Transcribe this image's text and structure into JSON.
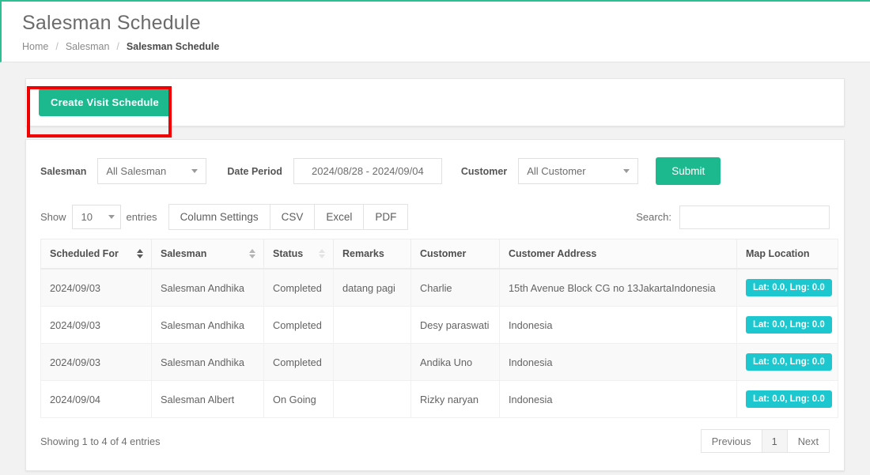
{
  "header": {
    "title": "Salesman Schedule",
    "breadcrumb": [
      {
        "label": "Home",
        "active": false
      },
      {
        "label": "Salesman",
        "active": false
      },
      {
        "label": "Salesman Schedule",
        "active": true
      }
    ],
    "separator": "/"
  },
  "action_card": {
    "create_button": "Create Visit Schedule"
  },
  "filters": {
    "salesman_label": "Salesman",
    "salesman_value": "All Salesman",
    "date_label": "Date Period",
    "date_value": "2024/08/28 - 2024/09/04",
    "customer_label": "Customer",
    "customer_value": "All Customer",
    "submit_label": "Submit"
  },
  "toolbar": {
    "show_label": "Show",
    "entries_label": "entries",
    "page_length": "10",
    "buttons": [
      "Column Settings",
      "CSV",
      "Excel",
      "PDF"
    ],
    "search_label": "Search:",
    "search_value": "",
    "search_placeholder": ""
  },
  "table": {
    "columns": [
      {
        "label": "Scheduled For",
        "sort": "active"
      },
      {
        "label": "Salesman",
        "sort": "mid"
      },
      {
        "label": "Status",
        "sort": "light"
      },
      {
        "label": "Remarks",
        "sort": "none"
      },
      {
        "label": "Customer",
        "sort": "none"
      },
      {
        "label": "Customer Address",
        "sort": "none"
      },
      {
        "label": "Map Location",
        "sort": "none"
      }
    ],
    "rows": [
      {
        "scheduled_for": "2024/09/03",
        "salesman": "Salesman Andhika",
        "status": "Completed",
        "remarks": "datang pagi",
        "customer": "Charlie",
        "customer_address": "15th Avenue Block CG no 13JakartaIndonesia",
        "map_location": "Lat: 0.0, Lng: 0.0"
      },
      {
        "scheduled_for": "2024/09/03",
        "salesman": "Salesman Andhika",
        "status": "Completed",
        "remarks": "",
        "customer": "Desy paraswati",
        "customer_address": "Indonesia",
        "map_location": "Lat: 0.0, Lng: 0.0"
      },
      {
        "scheduled_for": "2024/09/03",
        "salesman": "Salesman Andhika",
        "status": "Completed",
        "remarks": "",
        "customer": "Andika Uno",
        "customer_address": "Indonesia",
        "map_location": "Lat: 0.0, Lng: 0.0"
      },
      {
        "scheduled_for": "2024/09/04",
        "salesman": "Salesman Albert",
        "status": "On Going",
        "remarks": "",
        "customer": "Rizky naryan",
        "customer_address": "Indonesia",
        "map_location": "Lat: 0.0, Lng: 0.0"
      }
    ]
  },
  "footer": {
    "info": "Showing 1 to 4 of 4 entries",
    "previous": "Previous",
    "current_page": "1",
    "next": "Next"
  },
  "colors": {
    "teal": "#1cb98f",
    "badge_cyan": "#1dc7cf",
    "accent_border": "#2bbf91",
    "annotation_red": "#f00000",
    "page_background": "#f2f2f2"
  }
}
